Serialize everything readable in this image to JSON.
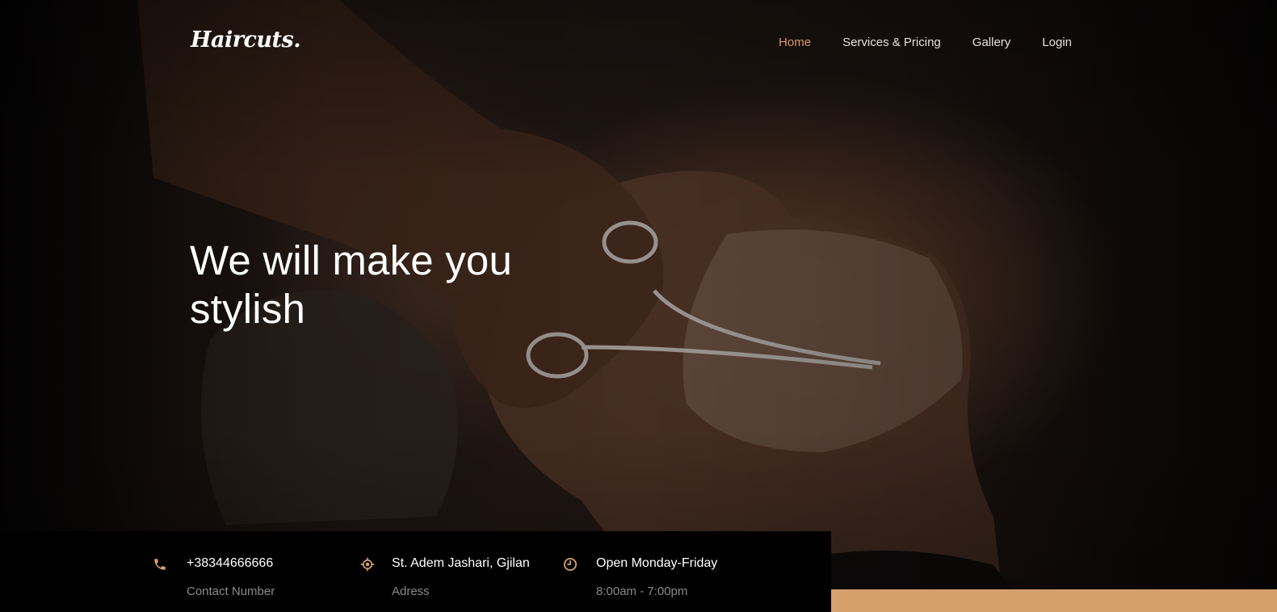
{
  "header": {
    "logo_text": "Haircuts.",
    "nav": [
      {
        "label": "Home",
        "active": true
      },
      {
        "label": "Services & Pricing",
        "active": false
      },
      {
        "label": "Gallery",
        "active": false
      },
      {
        "label": "Login",
        "active": false
      }
    ]
  },
  "hero": {
    "headline_line1": "We will make you",
    "headline_line2": "stylish"
  },
  "info": [
    {
      "icon": "phone-icon",
      "title": "+38344666666",
      "subtitle": "Contact Number"
    },
    {
      "icon": "location-icon",
      "title": "St. Adem Jashari, Gjilan",
      "subtitle": "Adress"
    },
    {
      "icon": "clock-icon",
      "title": "Open Monday-Friday",
      "subtitle": "8:00am - 7:00pm"
    }
  ],
  "colors": {
    "accent": "#d6a06d",
    "nav_active": "#d9995f",
    "info_bar": "#000000"
  }
}
